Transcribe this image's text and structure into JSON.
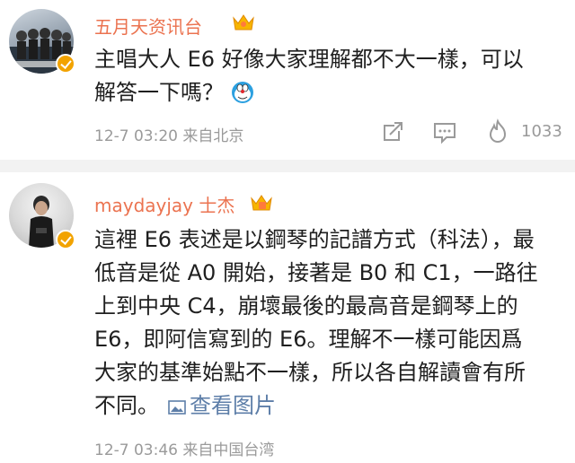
{
  "post1": {
    "username": "五月天资讯台",
    "text_lines": [
      "主唱大人 E6 好像大家理解都不大一樣，可以",
      "解答一下嗎？"
    ],
    "timestamp": "12-7 03:20",
    "source": "来自北京",
    "like_count": "1033"
  },
  "post2": {
    "username": "maydayjay 士杰",
    "text_lines": [
      "這裡 E6 表述是以鋼琴的記譜方式（科法），最",
      "低音是從 A0 開始，接著是 B0 和 C1，一路往",
      "上到中央 C4，崩壞最後的最高音是鋼琴上的",
      "E6，即阿信寫到的 E6。理解不一樣可能因爲",
      "大家的基準始點不一樣，所以各自解讀會有所",
      "不同。"
    ],
    "view_image_label": "查看图片",
    "timestamp": "12-7 03:46",
    "source": "来自中国台湾"
  },
  "colors": {
    "username": "#eb7350",
    "meta": "#9a9a9a",
    "link": "#5d7ea8",
    "verified_badge": "#f2a300"
  }
}
